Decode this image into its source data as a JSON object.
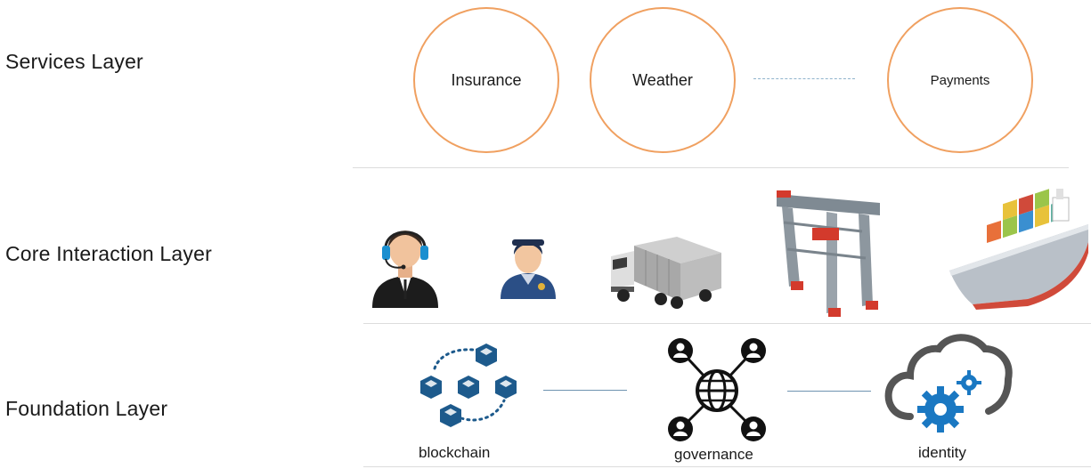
{
  "layers": {
    "services": "Services Layer",
    "core": "Core Interaction Layer",
    "foundation": "Foundation Layer"
  },
  "services": [
    "Insurance",
    "Weather",
    "Payments"
  ],
  "foundation": {
    "blockchain": "blockchain",
    "governance": "governance",
    "identity": "identity"
  },
  "icons": [
    "headset-agent-icon",
    "officer-icon",
    "truck-icon",
    "gantry-crane-icon",
    "container-ship-icon",
    "blockchain-cubes-icon",
    "network-globe-icon",
    "cloud-gears-icon"
  ],
  "colors": {
    "circle": "#f0a060",
    "cube": "#1d5a8c",
    "gear": "#1a78c2"
  }
}
